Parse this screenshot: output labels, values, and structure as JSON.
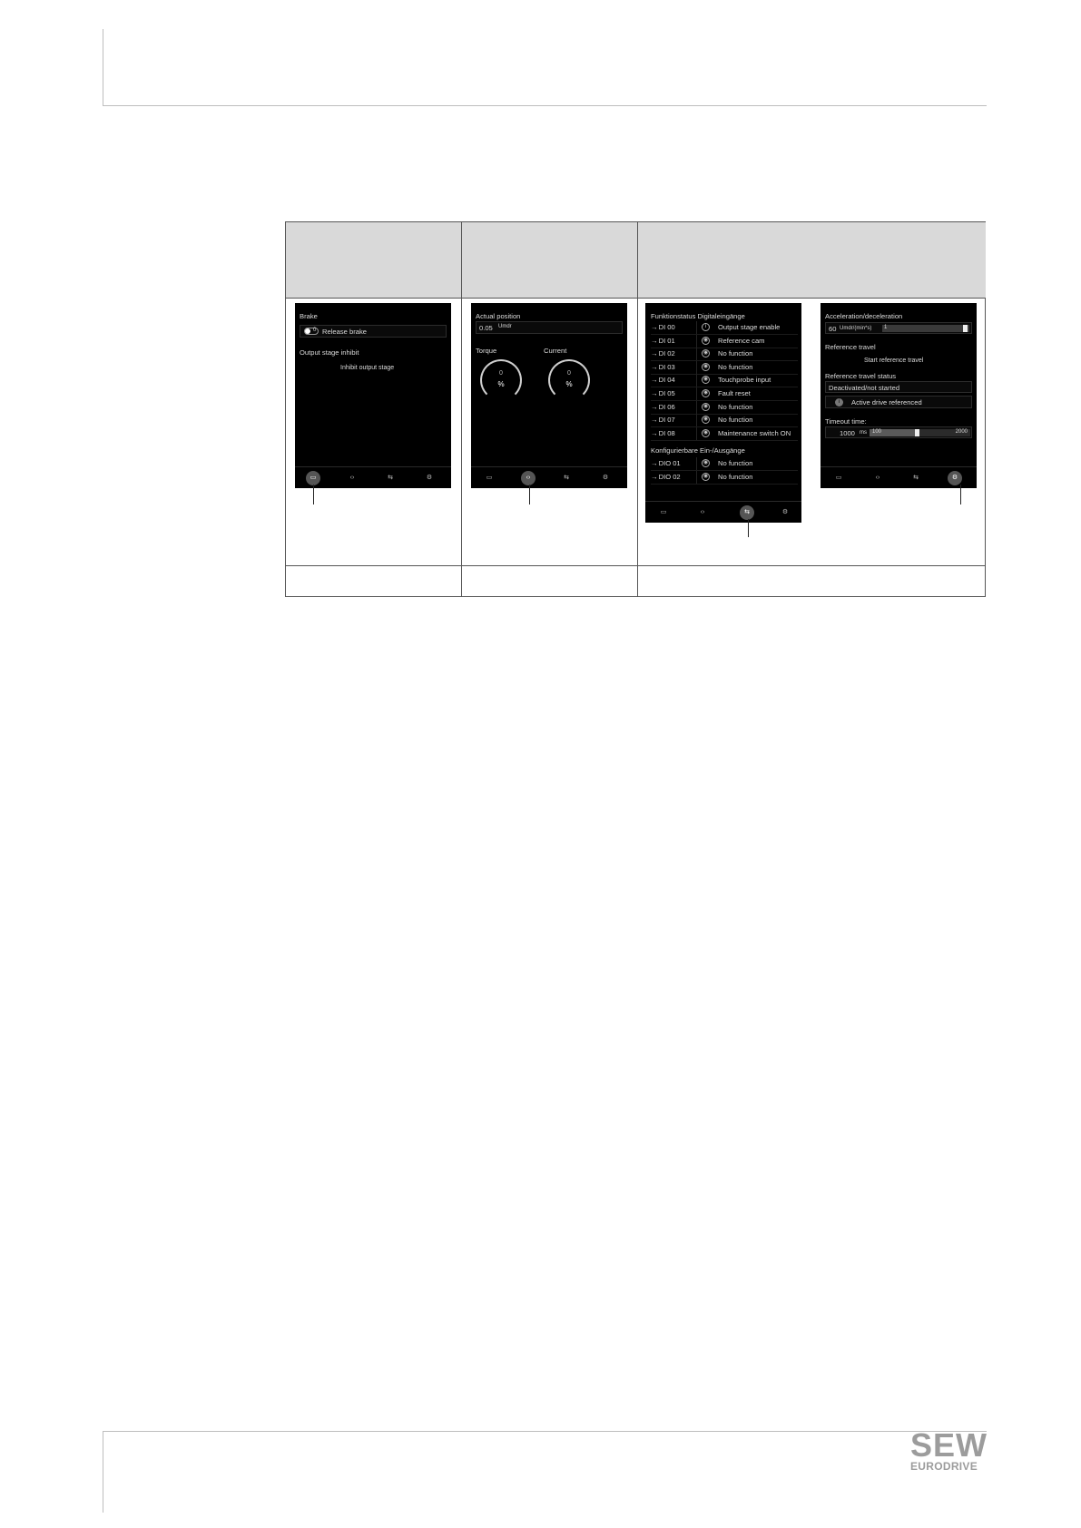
{
  "screen1": {
    "brake_label": "Brake",
    "toggle_value": "0",
    "release_brake": "Release brake",
    "output_stage_inhibit": "Output stage inhibit",
    "inhibit_output_stage": "Inhibit output stage"
  },
  "screen2": {
    "actual_position_label": "Actual position",
    "actual_position_value": "0.05",
    "actual_position_unit": "Umdr",
    "torque_label": "Torque",
    "current_label": "Current",
    "torque_value": "0",
    "torque_unit": "%",
    "current_value": "0",
    "current_unit": "%"
  },
  "screen3": {
    "title": "Funktionstatus Digitaleingänge",
    "inputs": [
      {
        "id": "DI 00",
        "function": "Output stage enable"
      },
      {
        "id": "DI 01",
        "function": "Reference cam"
      },
      {
        "id": "DI 02",
        "function": "No function"
      },
      {
        "id": "DI 03",
        "function": "No function"
      },
      {
        "id": "DI 04",
        "function": "Touchprobe input"
      },
      {
        "id": "DI 05",
        "function": "Fault reset"
      },
      {
        "id": "DI 06",
        "function": "No function"
      },
      {
        "id": "DI 07",
        "function": "No function"
      },
      {
        "id": "DI 08",
        "function": "Maintenance switch ON"
      }
    ],
    "configurable_title": "Konfigurierbare Ein-/Ausgänge",
    "configurable": [
      {
        "id": "DIO 01",
        "function": "No function"
      },
      {
        "id": "DIO 02",
        "function": "No function"
      }
    ]
  },
  "screen4": {
    "accel_label": "Acceleration/deceleration",
    "accel_value": "60",
    "accel_unit": "Umdr/(min*s)",
    "accel_slider_min": "1",
    "reference_travel_label": "Reference travel",
    "start_reference_travel": "Start reference travel",
    "reference_status_label": "Reference travel status",
    "status_value": "Deactivated/not started",
    "active_drive_referenced": "Active drive referenced",
    "timeout_label": "Timeout time:",
    "timeout_value": "1000",
    "timeout_unit": "ms",
    "slider_min": "100",
    "slider_max": "2000",
    "timeout_fraction": 0.47
  },
  "nav_icons": [
    "brake-icon",
    "position-icon",
    "io-icon",
    "settings-icon"
  ],
  "brand": {
    "logo_main": "SEW",
    "logo_sub": "EURODRIVE"
  }
}
